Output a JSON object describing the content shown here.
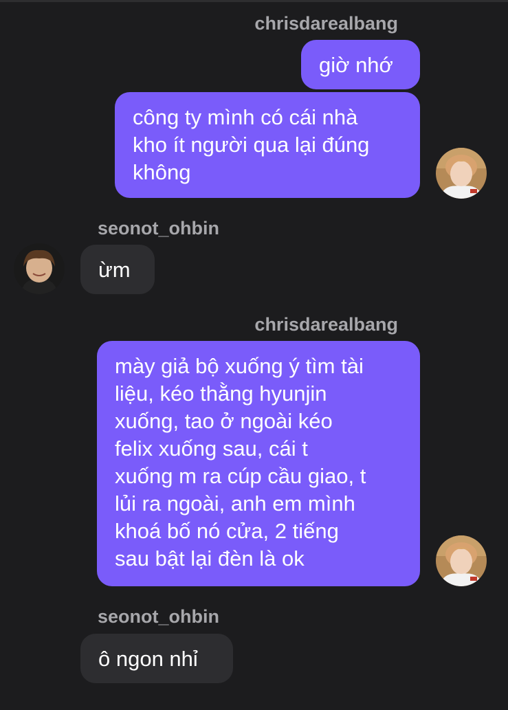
{
  "colors": {
    "background": "#1c1c1e",
    "sent_bubble": "#7a5cfa",
    "received_bubble": "#2d2d30",
    "username": "#a7a7ab",
    "text": "#ffffff"
  },
  "chat": {
    "group1": {
      "sender": "chrisdarealbang",
      "messages": [
        {
          "lines": [
            "giờ nhớ"
          ]
        },
        {
          "lines": [
            "công ty mình có cái nhà",
            "kho ít người qua lại đúng",
            "không"
          ]
        }
      ]
    },
    "group2": {
      "sender": "seonot_ohbin",
      "messages": [
        {
          "lines": [
            "ừm"
          ]
        }
      ]
    },
    "group3": {
      "sender": "chrisdarealbang",
      "messages": [
        {
          "lines": [
            "mày giả bộ xuống ý tìm tài",
            "liệu, kéo thằng hyunjin",
            "xuống, tao ở ngoài kéo",
            "felix xuống sau, cái t",
            "xuống m ra cúp cầu giao, t",
            "lủi ra ngoài, anh em mình",
            "khoá bố nó cửa, 2 tiếng",
            "sau bật lại đèn là ok"
          ]
        }
      ]
    },
    "group4": {
      "sender": "seonot_ohbin",
      "messages": [
        {
          "lines": [
            "ô ngon nhỉ"
          ]
        }
      ]
    }
  }
}
